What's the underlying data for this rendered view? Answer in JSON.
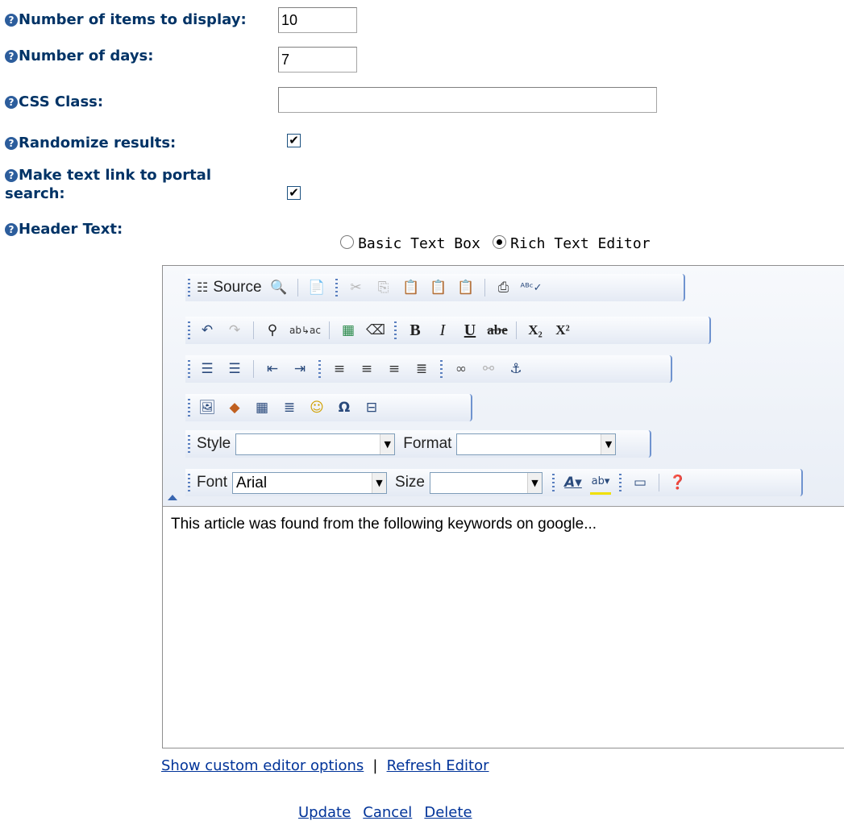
{
  "fields": {
    "items_label": "Number of items to display:",
    "items_value": "10",
    "days_label": "Number of days:",
    "days_value": "7",
    "css_label": "CSS Class:",
    "css_value": "",
    "randomize_label": "Randomize results:",
    "randomize_checked": true,
    "textlink_label_line1": "Make text link to portal",
    "textlink_label_line2": "search:",
    "textlink_checked": true,
    "header_label": "Header Text:"
  },
  "help_icon": "question-icon",
  "editor_mode": {
    "basic_label": "Basic Text Box",
    "rich_label": "Rich Text Editor",
    "selected": "rich"
  },
  "toolbar": {
    "source_label": "Source",
    "style_label": "Style",
    "style_value": "",
    "format_label": "Format",
    "format_value": "",
    "font_label": "Font",
    "font_value": "Arial",
    "size_label": "Size",
    "size_value": "",
    "bold": "B",
    "italic": "I",
    "underline": "U",
    "strike": "abe",
    "subscript": "X₂",
    "superscript": "X²",
    "omega": "Ω"
  },
  "editor_content": "This article was found from the following keywords on google...",
  "links": {
    "custom_options": "Show custom editor options",
    "divider": "|",
    "refresh": "Refresh Editor"
  },
  "actions": {
    "update": "Update",
    "cancel": "Cancel",
    "delete": "Delete"
  },
  "colors": {
    "label": "#003366",
    "link": "#003399",
    "toolbar_border": "#6f93cf"
  }
}
